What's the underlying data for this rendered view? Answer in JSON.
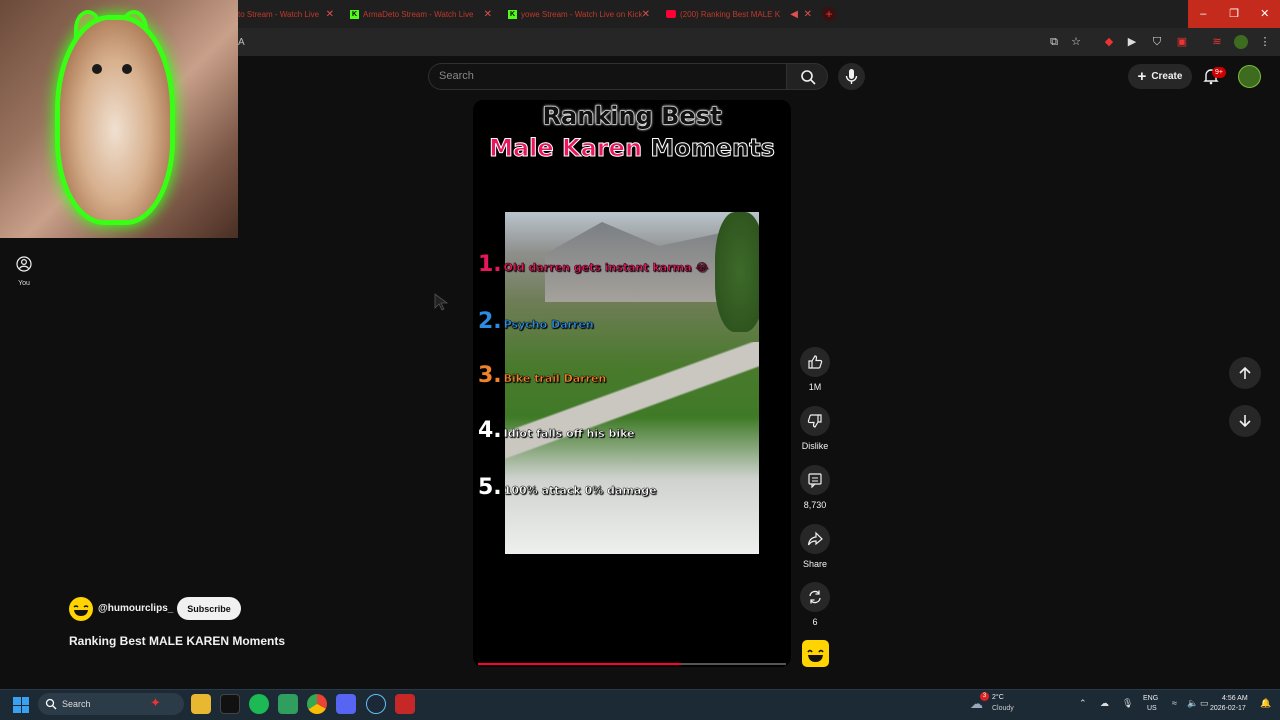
{
  "browser": {
    "tabs": [
      {
        "label": "to Stream - Watch Live",
        "icon": "kick-icon"
      },
      {
        "label": "ArmaDeto Stream - Watch Live",
        "icon": "kick-icon"
      },
      {
        "label": "yowe Stream - Watch Live on Kick",
        "icon": "kick-icon"
      },
      {
        "label": "(200) Ranking Best MALE K",
        "icon": "youtube-icon"
      }
    ],
    "address": "A",
    "window_controls": [
      "–",
      "❐",
      "✕"
    ]
  },
  "youtube": {
    "search_placeholder": "Search",
    "create_label": "Create",
    "notifications_badge": "9+",
    "sidebar_you": "You"
  },
  "short": {
    "title_line1": "Ranking Best",
    "title_line2_colored": "Male Karen",
    "title_line2_rest": "Moments",
    "ranks": [
      {
        "num": "1.",
        "text": "Old darren gets instant karma 😂",
        "color": "#e8175d"
      },
      {
        "num": "2.",
        "text": "Psycho Darren",
        "color": "#2b8ce0"
      },
      {
        "num": "3.",
        "text": "Bike trail Darren",
        "color": "#f0832a"
      },
      {
        "num": "4.",
        "text": "Idiot falls off his bike",
        "color": "#ffffff"
      },
      {
        "num": "5.",
        "text": "100% attack 0% damage",
        "color": "#ffffff"
      }
    ],
    "progress_fraction": 0.66,
    "channel_handle": "@humourclips_",
    "subscribe_label": "Subscribe",
    "video_title": "Ranking Best MALE KAREN Moments"
  },
  "actions": {
    "like_count": "1M",
    "dislike_label": "Dislike",
    "comments_count": "8,730",
    "share_label": "Share",
    "remix_count": "6"
  },
  "taskbar": {
    "search_label": "Search",
    "weather_temp": "2°C",
    "weather_desc": "Cloudy",
    "weather_badge": "3",
    "lang_line1": "ENG",
    "lang_line2": "US",
    "time": "4:56 AM",
    "date": "2026-02-17"
  },
  "colors": {
    "youtube_red": "#ff0033",
    "accent_pink": "#e8175d",
    "glow_green": "#39ff14"
  }
}
